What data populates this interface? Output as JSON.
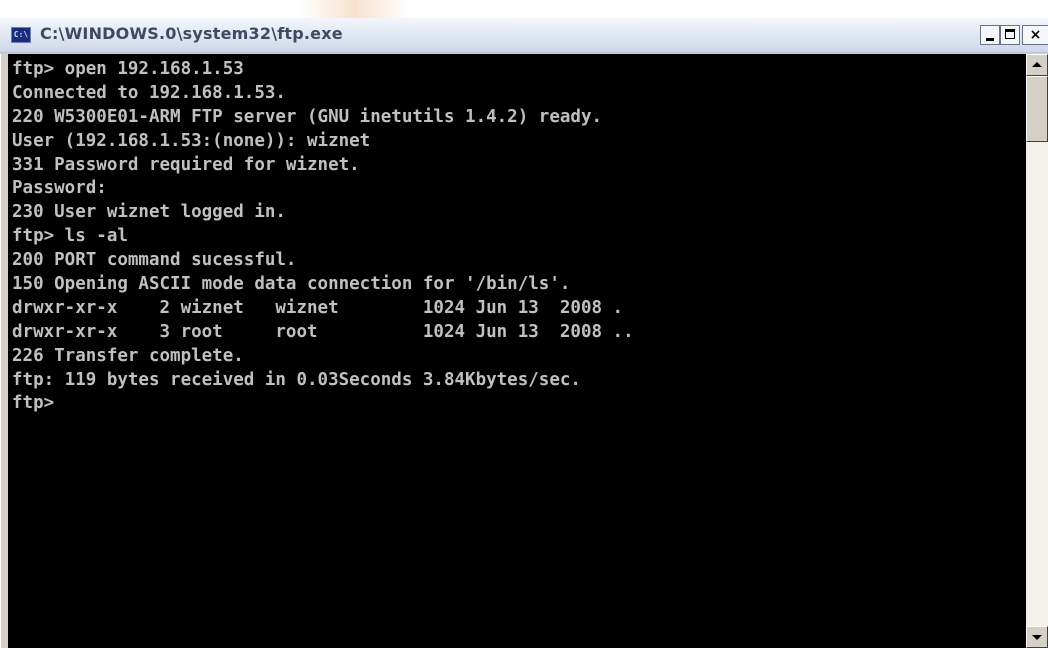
{
  "window": {
    "title": "C:\\WINDOWS.0\\system32\\ftp.exe",
    "icon": "console-app-icon",
    "icon_glyph": "C:\\",
    "controls": {
      "minimize": "minimize-icon",
      "maximize": "maximize-icon",
      "close_label": "×"
    }
  },
  "console": {
    "lines": [
      "ftp> open 192.168.1.53",
      "Connected to 192.168.1.53.",
      "220 W5300E01-ARM FTP server (GNU inetutils 1.4.2) ready.",
      "User (192.168.1.53:(none)): wiznet",
      "331 Password required for wiznet.",
      "Password:",
      "230 User wiznet logged in.",
      "ftp> ls -al",
      "200 PORT command sucessful.",
      "150 Opening ASCII mode data connection for '/bin/ls'.",
      "drwxr-xr-x    2 wiznet   wiznet        1024 Jun 13  2008 .",
      "drwxr-xr-x    3 root     root          1024 Jun 13  2008 ..",
      "226 Transfer complete.",
      "ftp: 119 bytes received in 0.03Seconds 3.84Kbytes/sec.",
      "ftp>"
    ]
  },
  "scrollbar": {
    "up_icon": "scroll-up-arrow-icon",
    "down_icon": "scroll-down-arrow-icon"
  },
  "colors": {
    "console_bg": "#000000",
    "console_text": "#c0c0c0",
    "titlebar": "#dfe5f1"
  }
}
